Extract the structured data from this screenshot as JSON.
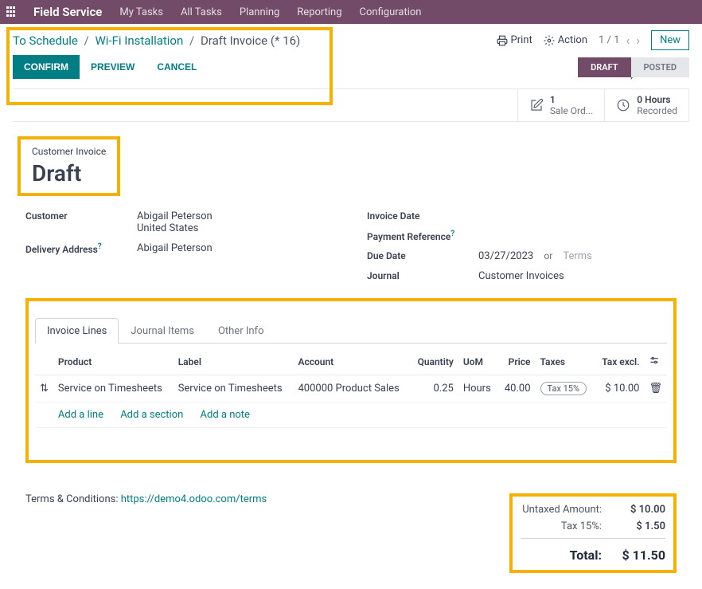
{
  "topbar": {
    "brand": "Field Service",
    "nav": [
      "My Tasks",
      "All Tasks",
      "Planning",
      "Reporting",
      "Configuration"
    ]
  },
  "breadcrumb": {
    "a": "To Schedule",
    "b": "Wi-Fi Installation",
    "c": "Draft Invoice (* 16)"
  },
  "header": {
    "print": "Print",
    "action": "Action",
    "pager": "1 / 1",
    "newBtn": "New"
  },
  "actions": {
    "confirm": "CONFIRM",
    "preview": "PREVIEW",
    "cancel": "CANCEL"
  },
  "status": {
    "draft": "DRAFT",
    "posted": "POSTED"
  },
  "stats": {
    "sale": {
      "num": "1",
      "label": "Sale Ord..."
    },
    "hours": {
      "num": "0 Hours",
      "label": "Recorded"
    }
  },
  "doc": {
    "small": "Customer Invoice",
    "title": "Draft",
    "customerLabel": "Customer",
    "customerName": "Abigail Peterson",
    "customerCountry": "United States",
    "deliveryLabel": "Delivery Address",
    "deliveryValue": "Abigail Peterson",
    "invDateLabel": "Invoice Date",
    "payRefLabel": "Payment Reference",
    "dueDateLabel": "Due Date",
    "dueDateValue": "03/27/2023",
    "or": "or",
    "termsPh": "Terms",
    "journalLabel": "Journal",
    "journalValue": "Customer Invoices"
  },
  "tabs": [
    "Invoice Lines",
    "Journal Items",
    "Other Info"
  ],
  "lineHeaders": {
    "product": "Product",
    "label": "Label",
    "account": "Account",
    "qty": "Quantity",
    "uom": "UoM",
    "price": "Price",
    "taxes": "Taxes",
    "taxexcl": "Tax excl."
  },
  "line": {
    "product": "Service on Timesheets",
    "label": "Service on Timesheets",
    "account": "400000 Product Sales",
    "qty": "0.25",
    "uom": "Hours",
    "price": "40.00",
    "tax": "Tax 15%",
    "taxexcl": "$ 10.00"
  },
  "addActions": {
    "line": "Add a line",
    "section": "Add a section",
    "note": "Add a note"
  },
  "footer": {
    "tcLabel": "Terms & Conditions: ",
    "tcLink": "https://demo4.odoo.com/terms",
    "untaxedL": "Untaxed Amount:",
    "untaxedV": "$ 10.00",
    "taxL": "Tax 15%:",
    "taxV": "$ 1.50",
    "totalL": "Total:",
    "totalV": "$ 11.50"
  }
}
